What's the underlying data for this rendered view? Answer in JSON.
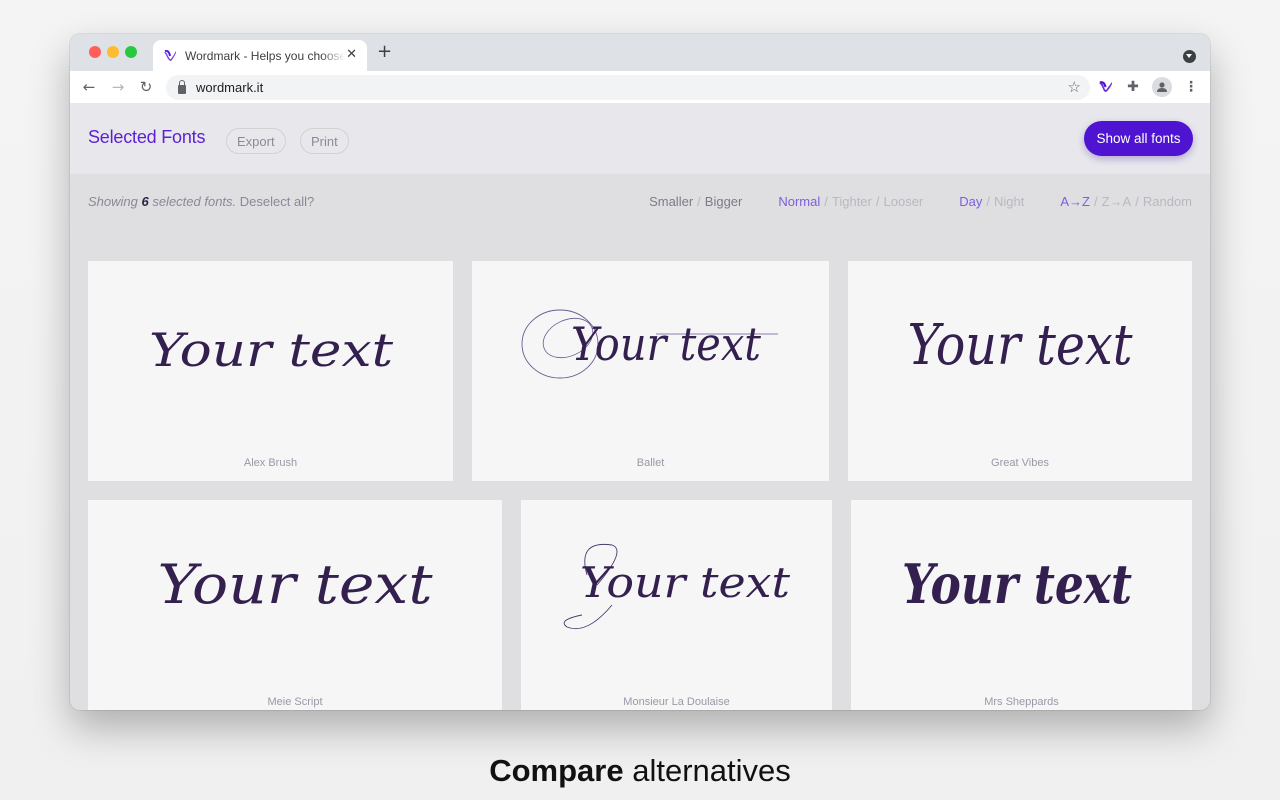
{
  "browser": {
    "tab_title": "Wordmark - Helps you choose fonts",
    "tab_close_glyph": "✕",
    "new_tab_glyph": "+",
    "url": "wordmark.it",
    "back_glyph": "←",
    "forward_glyph": "→",
    "reload_glyph": "↻",
    "star_glyph": "☆",
    "puzzle_glyph": "✚",
    "menu_glyph": "⋮",
    "icons": [
      "back-arrow-icon",
      "forward-arrow-icon",
      "reload-icon",
      "lock-icon",
      "bookmark-star-icon",
      "wordmark-extension-icon",
      "extensions-puzzle-icon",
      "profile-avatar-icon",
      "browser-menu-icon",
      "tab-search-icon"
    ]
  },
  "header": {
    "title": "Selected Fonts",
    "export_label": "Export",
    "print_label": "Print",
    "show_all_label": "Show all fonts"
  },
  "filterbar": {
    "showing_prefix": "Showing ",
    "count": "6",
    "showing_suffix": " selected fonts.",
    "deselect_label": " Deselect all?",
    "size": {
      "smaller": "Smaller",
      "bigger": "Bigger"
    },
    "spacing": {
      "normal": "Normal",
      "tighter": "Tighter",
      "looser": "Looser",
      "active": "Normal"
    },
    "theme": {
      "day": "Day",
      "night": "Night",
      "active": "Day"
    },
    "sort": {
      "az": "A→Z",
      "za": "Z→A",
      "random": "Random",
      "active": "A→Z"
    },
    "separator": "/"
  },
  "fonts": [
    {
      "sample": "Your text",
      "name": "Alex Brush"
    },
    {
      "sample": "Your text",
      "name": "Ballet"
    },
    {
      "sample": "Your text",
      "name": "Great Vibes"
    },
    {
      "sample": "Your text",
      "name": "Meie Script"
    },
    {
      "sample": "Your text",
      "name": "Monsieur La Doulaise"
    },
    {
      "sample": "Your text",
      "name": "Mrs Sheppards"
    }
  ],
  "colors": {
    "accent": "#4e14d1",
    "title": "#5b1fd6",
    "sample_ink": "#33204f",
    "active_control": "#7f5ce0"
  },
  "caption": {
    "bold": "Compare",
    "rest": " alternatives"
  }
}
